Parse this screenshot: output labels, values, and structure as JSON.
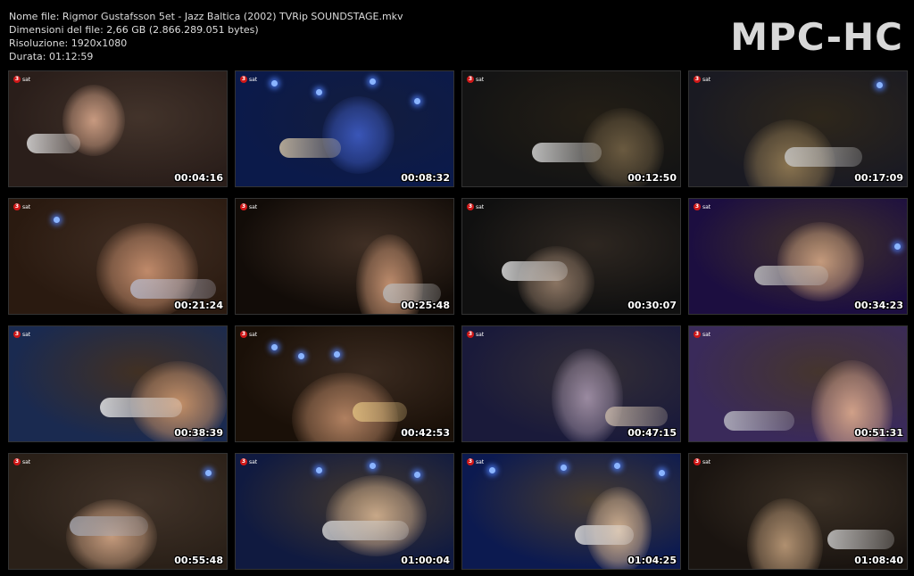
{
  "header": {
    "file_name": "Nome file: Rigmor Gustafsson 5et - Jazz Baltica (2002) TVRip SOUNDSTAGE.mkv",
    "file_size": "Dimensioni del file: 2,66 GB (2.866.289.051 bytes)",
    "resolution": "Risoluzione: 1920x1080",
    "duration": "Durata: 01:12:59"
  },
  "logo": "MPC-HC",
  "channel_logo_text": "3sat",
  "thumbnails": [
    {
      "time": "00:04:16",
      "bg": "#2a1e1a",
      "fg": "#c89a80",
      "accent": "#e8e8e8"
    },
    {
      "time": "00:08:32",
      "bg": "#0b1a4a",
      "fg": "#3a56b8",
      "accent": "#d9c8a8"
    },
    {
      "time": "00:12:50",
      "bg": "#141414",
      "fg": "#6a5a40",
      "accent": "#e0e0e0"
    },
    {
      "time": "00:17:09",
      "bg": "#1a1a22",
      "fg": "#8a7450",
      "accent": "#c8c8c8"
    },
    {
      "time": "00:21:24",
      "bg": "#2a1a10",
      "fg": "#c08a6a",
      "accent": "#b8b8c8"
    },
    {
      "time": "00:25:48",
      "bg": "#120c08",
      "fg": "#c08e6e",
      "accent": "#b8b8b8"
    },
    {
      "time": "00:30:07",
      "bg": "#101010",
      "fg": "#8a7462",
      "accent": "#e8e8e8"
    },
    {
      "time": "00:34:23",
      "bg": "#1c0e40",
      "fg": "#c49a7c",
      "accent": "#c8c8c8"
    },
    {
      "time": "00:38:39",
      "bg": "#1a2a50",
      "fg": "#c49068",
      "accent": "#f0f0f0"
    },
    {
      "time": "00:42:53",
      "bg": "#1a1008",
      "fg": "#b08060",
      "accent": "#e0c080"
    },
    {
      "time": "00:47:15",
      "bg": "#1a1a3a",
      "fg": "#9a8aa0",
      "accent": "#c8b8a8"
    },
    {
      "time": "00:51:31",
      "bg": "#3a2a5a",
      "fg": "#d0a088",
      "accent": "#c0c0c8"
    },
    {
      "time": "00:55:48",
      "bg": "#2a2018",
      "fg": "#c49a7c",
      "accent": "#a8a8b0"
    },
    {
      "time": "01:00:04",
      "bg": "#101a40",
      "fg": "#c8a888",
      "accent": "#d8d8d8"
    },
    {
      "time": "01:04:25",
      "bg": "#0c1a50",
      "fg": "#d0b090",
      "accent": "#e8e8e8"
    },
    {
      "time": "01:08:40",
      "bg": "#1a1410",
      "fg": "#b09070",
      "accent": "#d0d0d0"
    }
  ]
}
